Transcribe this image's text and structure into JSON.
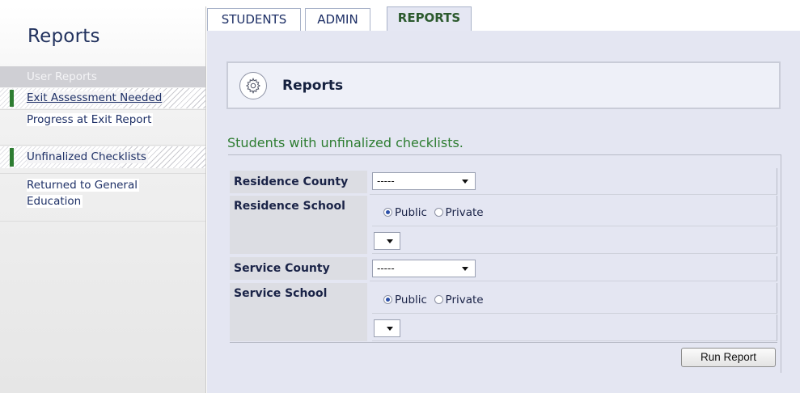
{
  "sidebar": {
    "title": "Reports",
    "section": "User Reports",
    "items": [
      {
        "label": "Exit Assessment Needed"
      },
      {
        "label": "Progress at Exit Report"
      },
      {
        "label": "Unfinalized Checklists"
      },
      {
        "label": "Returned to General"
      },
      {
        "label": "Education"
      }
    ]
  },
  "tabs": [
    {
      "label": "STUDENTS"
    },
    {
      "label": "ADMIN"
    },
    {
      "label": "REPORTS"
    }
  ],
  "main": {
    "header_title": "Reports",
    "subtitle": "Students with unfinalized checklists.",
    "fields": {
      "residence_county": {
        "label": "Residence County",
        "value": "-----"
      },
      "residence_school": {
        "label": "Residence School",
        "radio_public": "Public",
        "radio_private": "Private",
        "selected": "Public"
      },
      "service_county": {
        "label": "Service County",
        "value": "-----"
      },
      "service_school": {
        "label": "Service School",
        "radio_public": "Public",
        "radio_private": "Private",
        "selected": "Public"
      }
    },
    "run_button": "Run Report"
  },
  "icons": {
    "header": "gear-icon",
    "select_arrow": "chevron-down-icon"
  },
  "colors": {
    "accent_green": "#2e7d32",
    "panel_bg": "#e4e6f2",
    "label_bg": "#dcdde3",
    "nav_text": "#1d2f66"
  }
}
